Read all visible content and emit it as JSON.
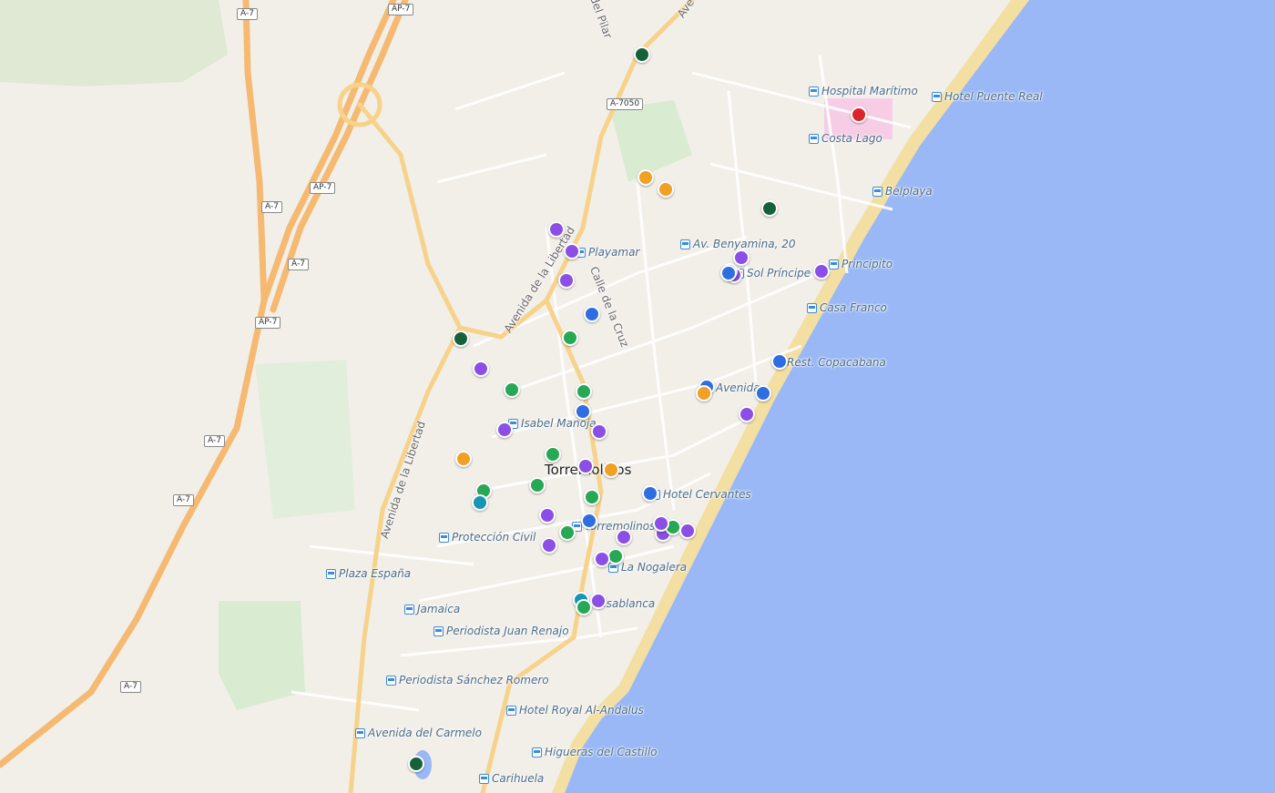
{
  "map": {
    "colors": {
      "land": "#f2efe9",
      "sea": "#99b8f5",
      "beach": "#f3dfa2",
      "motorway": "#f5b971",
      "trunk": "#f7d28a",
      "park": "#d9ecd2",
      "hospital": "#f6cde4"
    },
    "town_label": "Torremolinos",
    "street_labels": [
      "Avenida de la Libertad",
      "Avenida de la Libertad",
      "Calle de la Cruz",
      "del Pilar",
      "Ave"
    ],
    "road_shields": [
      "A-7",
      "AP-7",
      "A-7050",
      "A-7",
      "AP-7",
      "A-7",
      "AP-7",
      "A-7",
      "A-7",
      "A-7"
    ],
    "stops": [
      "Hospital Marítimo",
      "Hotel Puente Real",
      "Costa Lago",
      "Belplaya",
      "Playamar",
      "Av. Benyamina, 20",
      "Sol Príncipe",
      "Principito",
      "Casa Franco",
      "Rest. Copacabana",
      "Avenida",
      "Isabel Manoja",
      "Hotel Cervantes",
      "Torremolinos",
      "Protección Civil",
      "La Nogalera",
      "Plaza España",
      "Jamaica",
      "Periodista Juan Renajo",
      "Periodista Sánchez Romero",
      "Hotel Royal Al-Andalus",
      "Avenida del Carmelo",
      "Higueras del Castillo",
      "Carihuela",
      "Casablanca"
    ],
    "marker_colors": {
      "purple": "#8b4fe5",
      "blue": "#2f6ee0",
      "green": "#26a854",
      "darkgreen": "#17613a",
      "orange": "#f0a024",
      "teal": "#1796b3",
      "red": "#d9262c"
    },
    "markers": [
      {
        "type": "darkgreen"
      },
      {
        "type": "orange"
      },
      {
        "type": "orange"
      },
      {
        "type": "darkgreen"
      },
      {
        "type": "purple"
      },
      {
        "type": "purple"
      },
      {
        "type": "purple"
      },
      {
        "type": "blue"
      },
      {
        "type": "purple"
      },
      {
        "type": "purple"
      },
      {
        "type": "purple"
      },
      {
        "type": "blue"
      },
      {
        "type": "darkgreen"
      },
      {
        "type": "green"
      },
      {
        "type": "purple"
      },
      {
        "type": "green"
      },
      {
        "type": "green"
      },
      {
        "type": "blue"
      },
      {
        "type": "purple"
      },
      {
        "type": "purple"
      },
      {
        "type": "blue"
      },
      {
        "type": "orange"
      },
      {
        "type": "blue"
      },
      {
        "type": "blue"
      },
      {
        "type": "purple"
      },
      {
        "type": "orange"
      },
      {
        "type": "green"
      },
      {
        "type": "purple"
      },
      {
        "type": "orange"
      },
      {
        "type": "green"
      },
      {
        "type": "teal"
      },
      {
        "type": "green"
      },
      {
        "type": "green"
      },
      {
        "type": "blue"
      },
      {
        "type": "purple"
      },
      {
        "type": "purple"
      },
      {
        "type": "green"
      },
      {
        "type": "blue"
      },
      {
        "type": "purple"
      },
      {
        "type": "purple"
      },
      {
        "type": "green"
      },
      {
        "type": "purple"
      },
      {
        "type": "green"
      },
      {
        "type": "purple"
      },
      {
        "type": "purple"
      },
      {
        "type": "teal"
      },
      {
        "type": "green"
      },
      {
        "type": "purple"
      },
      {
        "type": "darkgreen"
      },
      {
        "type": "red"
      },
      {
        "type": "blue"
      }
    ]
  }
}
